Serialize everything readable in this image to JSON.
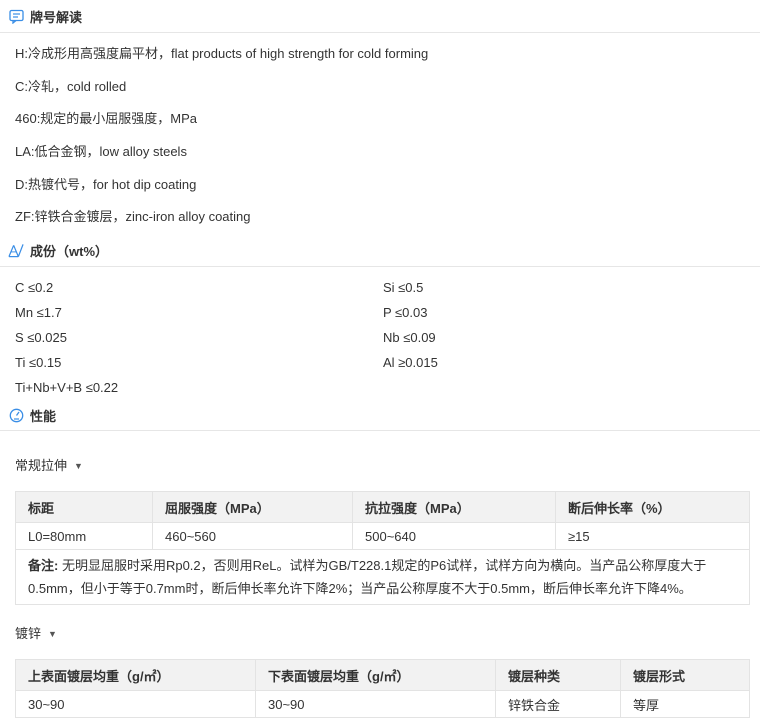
{
  "brand_section": {
    "title": "牌号解读",
    "icon": "comment-icon",
    "lines": [
      "H:冷成形用高强度扁平材，flat products of high strength for cold forming",
      "C:冷轧，cold rolled",
      "460:规定的最小屈服强度，MPa",
      "LA:低合金钢，low alloy steels",
      "D:热镀代号，for hot dip coating",
      "ZF:锌铁合金镀层，zinc-iron alloy coating"
    ]
  },
  "composition_section": {
    "title": "成份（wt%）",
    "icon": "flask-icon",
    "items": [
      "C ≤0.2",
      "Si ≤0.5",
      "Mn ≤1.7",
      "P ≤0.03",
      "S ≤0.025",
      "Nb ≤0.09",
      "Ti ≤0.15",
      "Al ≥0.015",
      "Ti+Nb+V+B ≤0.22"
    ]
  },
  "performance_section": {
    "title": "性能",
    "icon": "gauge-icon",
    "tensile": {
      "label": "常规拉伸",
      "headers": [
        "标距",
        "屈服强度（MPa）",
        "抗拉强度（MPa）",
        "断后伸长率（%）"
      ],
      "row": [
        "L0=80mm",
        "460~560",
        "500~640",
        "≥15"
      ],
      "note_label": "备注:",
      "note_text": " 无明显屈服时采用Rp0.2，否则用ReL。试样为GB/T228.1规定的P6试样，试样方向为横向。当产品公称厚度大于0.5mm，但小于等于0.7mm时，断后伸长率允许下降2%；当产品公称厚度不大于0.5mm，断后伸长率允许下降4%。"
    },
    "coating": {
      "label": "镀锌",
      "headers": [
        "上表面镀层均重（g/㎡）",
        "下表面镀层均重（g/㎡）",
        "镀层种类",
        "镀层形式"
      ],
      "row": [
        "30~90",
        "30~90",
        "锌铁合金",
        "等厚"
      ]
    }
  },
  "colors": {
    "icon": "#3a8ee6",
    "border": "#e3e3e3",
    "header_bg": "#f2f2f2"
  }
}
